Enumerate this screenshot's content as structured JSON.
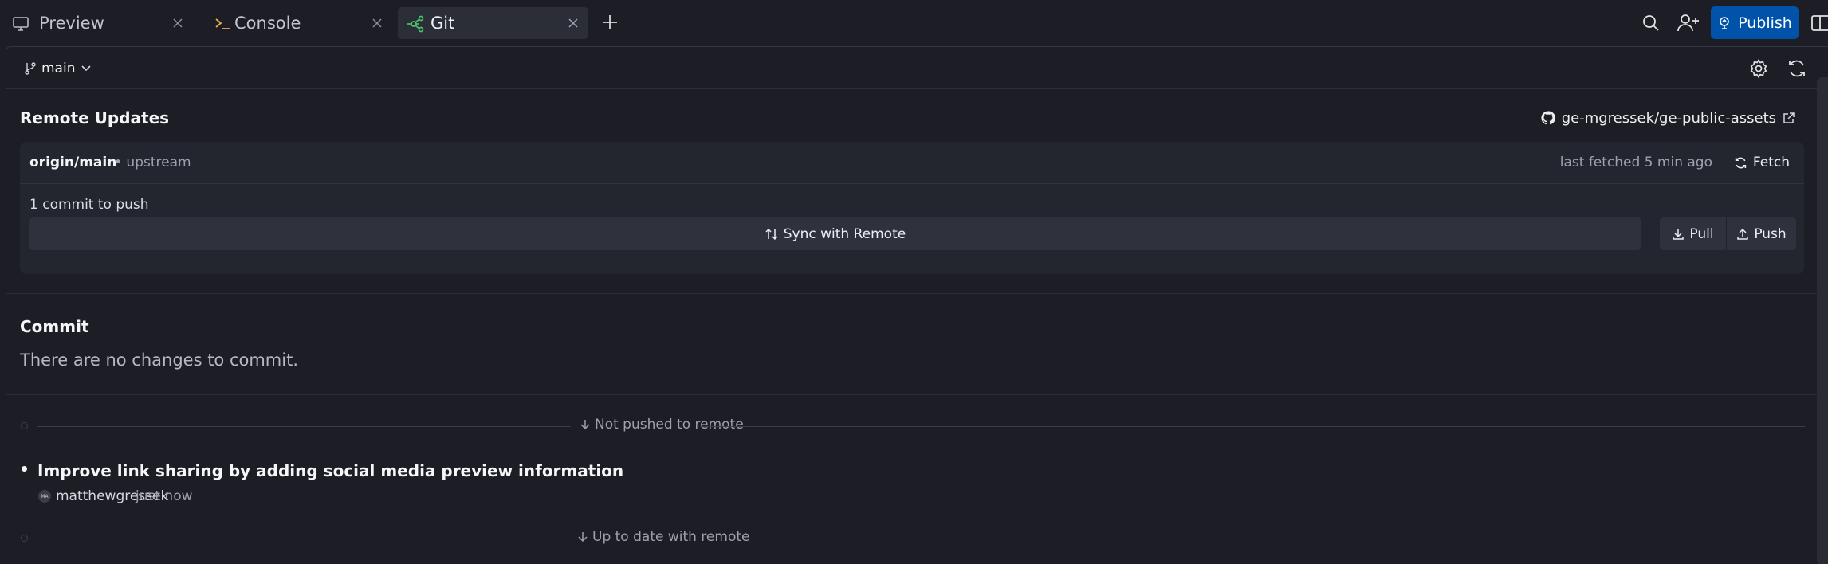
{
  "tabs": [
    {
      "label": "Preview",
      "icon": "monitor-icon",
      "active": false
    },
    {
      "label": "Console",
      "icon": "terminal-icon",
      "active": false
    },
    {
      "label": "Git",
      "icon": "git-icon",
      "active": true
    }
  ],
  "toolbar": {
    "publish_label": "Publish",
    "icons": [
      "search-icon",
      "add-user-icon",
      "split-view-icon"
    ]
  },
  "branch": {
    "name": "main"
  },
  "remote_updates": {
    "title": "Remote Updates",
    "repo": "ge-mgressek/ge-public-assets",
    "remote_branch": "origin/main",
    "remote_meta": "• upstream",
    "last_fetched": "last fetched 5 min ago",
    "fetch_label": "Fetch",
    "commit_count": "1 commit to push",
    "sync_label": "Sync with Remote",
    "pull_label": "Pull",
    "push_label": "Push"
  },
  "commit": {
    "title": "Commit",
    "empty_message": "There are no changes to commit."
  },
  "timeline": {
    "not_pushed_label": "Not pushed to remote",
    "up_to_date_label": "Up to date with remote",
    "commits": [
      {
        "message": "Improve link sharing by adding social media preview information",
        "author_initials": "MA",
        "author": "matthewgressek",
        "time": "just now"
      }
    ]
  },
  "colors": {
    "background": "#1c1d25",
    "card": "#24262f",
    "accent": "#0053a8",
    "git_icon": "#4fbf6a",
    "console_icon": "#e0b04a"
  }
}
